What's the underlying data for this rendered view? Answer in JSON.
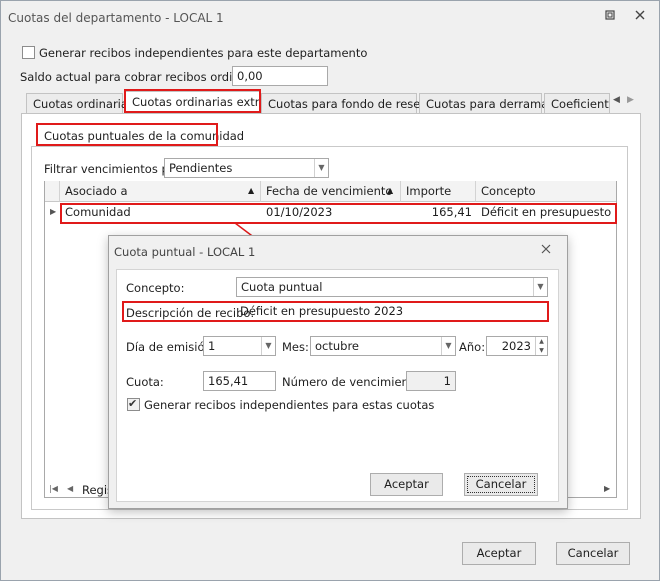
{
  "window": {
    "title": "Cuotas del departamento - LOCAL 1",
    "accept_label": "Aceptar",
    "cancel_label": "Cancelar"
  },
  "top": {
    "independent_receipts_label": "Generar recibos independientes para este departamento",
    "independent_receipts_checked": false,
    "balance_label": "Saldo actual para cobrar recibos ordinarios:",
    "balance_value": "0,00"
  },
  "tabs": [
    {
      "label": "Cuotas ordinarias",
      "active": false
    },
    {
      "label": "Cuotas ordinarias extras",
      "active": true
    },
    {
      "label": "Cuotas para fondo de reserva",
      "active": false
    },
    {
      "label": "Cuotas para derramas",
      "active": false
    },
    {
      "label": "Coeficientes",
      "active": false
    }
  ],
  "group": {
    "title": "Cuotas puntuales de la comunidad",
    "filter_label": "Filtrar vencimientos por:",
    "filter_value": "Pendientes"
  },
  "grid": {
    "columns": [
      "Asociado a",
      "Fecha de vencimiento",
      "Importe",
      "Concepto"
    ],
    "rows": [
      {
        "asociado": "Comunidad",
        "fecha": "01/10/2023",
        "importe": "165,41",
        "concepto": "Déficit en presupuesto 2023"
      }
    ],
    "footer_text": "Regis"
  },
  "dialog": {
    "title": "Cuota puntual - LOCAL 1",
    "concepto_label": "Concepto:",
    "concepto_value": "Cuota puntual",
    "descripcion_label": "Descripción de recibo:",
    "descripcion_value": "Déficit en presupuesto 2023",
    "dia_label": "Día de emisión:",
    "dia_value": "1",
    "mes_label": "Mes:",
    "mes_value": "octubre",
    "anio_label": "Año:",
    "anio_value": "2023",
    "cuota_label": "Cuota:",
    "cuota_value": "165,41",
    "num_venc_label": "Número de vencimientos:",
    "num_venc_value": "1",
    "generate_label": "Generar recibos independientes para estas cuotas",
    "generate_checked": true,
    "accept_label": "Aceptar",
    "cancel_label": "Cancelar"
  },
  "colors": {
    "highlight": "#e01a1a",
    "window_bg": "#f0f0f0"
  }
}
